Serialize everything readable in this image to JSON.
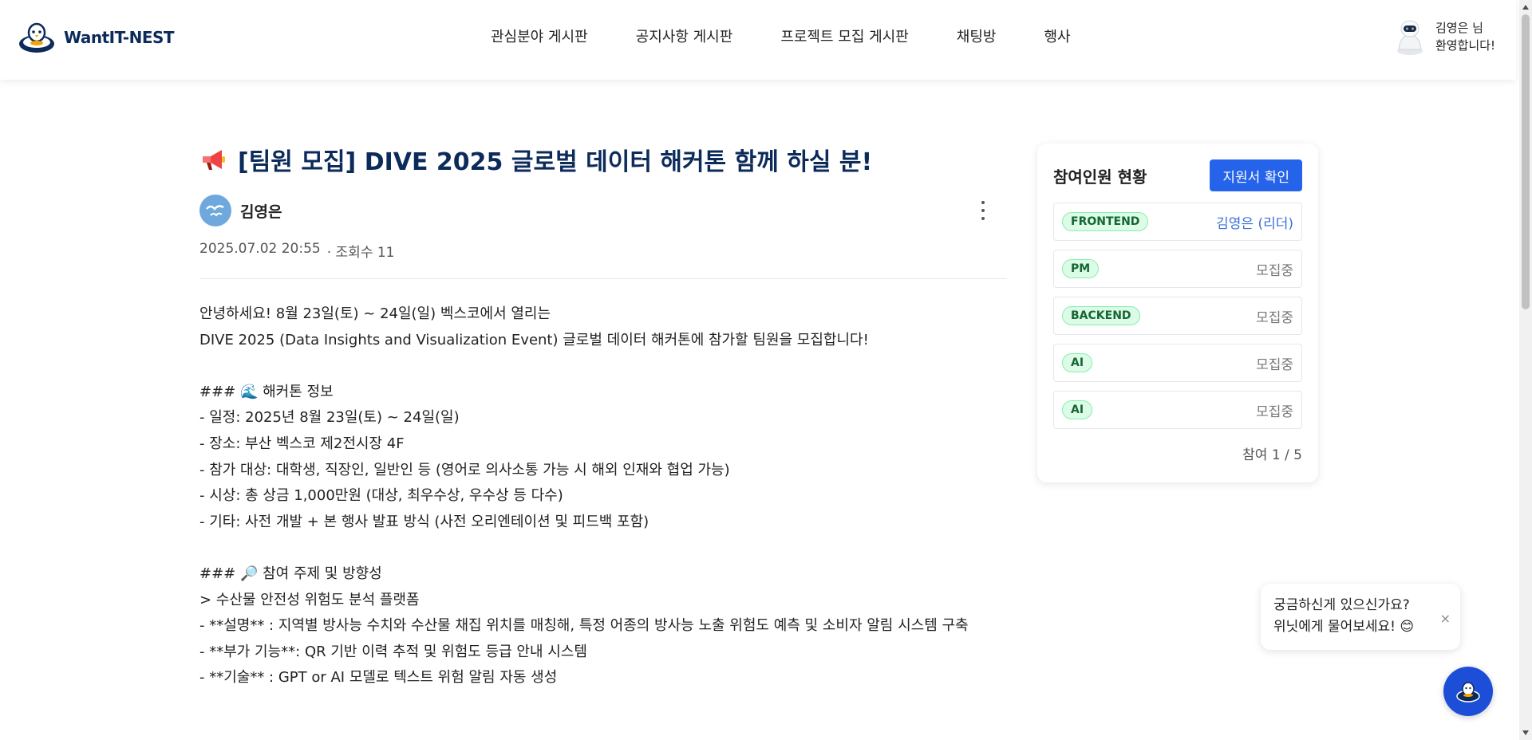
{
  "header": {
    "logo_text": "WantIT-NEST",
    "nav": [
      "관심분야 게시판",
      "공지사항 게시판",
      "프로젝트 모집 게시판",
      "채팅방",
      "행사"
    ],
    "user_greeting_line1": "김영은 님",
    "user_greeting_line2": "환영합니다!"
  },
  "post": {
    "icon": "megaphone-icon",
    "title": "[팀원 모집] DIVE 2025 글로벌 데이터 해커톤 함께 하실 분!",
    "author": "김영은",
    "date": "2025.07.02 20:55",
    "views": "· 조회수 11",
    "body": [
      "안녕하세요! 8월 23일(토) ~ 24일(일) 벡스코에서 열리는",
      "DIVE 2025 (Data Insights and Visualization Event) 글로벌 데이터 해커톤에 참가할 팀원을 모집합니다!",
      "",
      "### 🌊 해커톤 정보",
      "- 일정: 2025년 8월 23일(토) ~ 24일(일)",
      "- 장소: 부산 벡스코 제2전시장 4F",
      "- 참가 대상: 대학생, 직장인, 일반인 등 (영어로 의사소통 가능 시 해외 인재와 협업 가능)",
      "- 시상: 총 상금 1,000만원 (대상, 최우수상, 우수상 등 다수)",
      "- 기타: 사전 개발 + 본 행사 발표 방식 (사전 오리엔테이션 및 피드백 포함)",
      "",
      "### 🔎 참여 주제 및 방향성",
      "> 수산물 안전성 위험도 분석 플랫폼",
      "- **설명** : 지역별 방사능 수치와 수산물 채집 위치를 매칭해, 특정 어종의 방사능 노출 위험도 예측 및 소비자 알림 시스템 구축",
      "- **부가 기능**: QR 기반 이력 추적 및 위험도 등급 안내 시스템",
      "- **기술** : GPT or AI 모델로 텍스트 위험 알림 자동 생성"
    ]
  },
  "sidebar": {
    "title": "참여인원 현황",
    "apply_button": "지원서 확인",
    "slots": [
      {
        "role": "FRONTEND",
        "status": "김영은 (리더)"
      },
      {
        "role": "PM",
        "status": "모집중"
      },
      {
        "role": "BACKEND",
        "status": "모집중"
      },
      {
        "role": "AI",
        "status": "모집중"
      },
      {
        "role": "AI",
        "status": "모집중"
      }
    ],
    "count": "참여 1 / 5"
  },
  "chat": {
    "bubble_line1": "궁금하신게 있으신가요?",
    "bubble_line2": "위닛에게 물어보세요! 😊",
    "close": "×"
  },
  "colors": {
    "primary": "#2563eb",
    "title_navy": "#0c2b5b",
    "tag_green_bg": "#dcfce7",
    "tag_green_text": "#166534"
  }
}
